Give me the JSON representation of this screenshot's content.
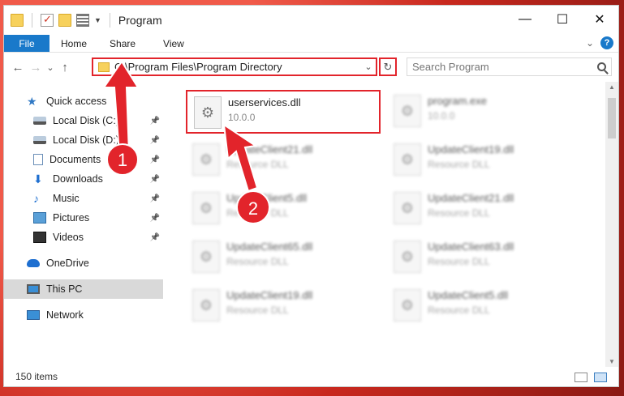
{
  "window": {
    "title": "Program",
    "minimize_glyph": "—",
    "maximize_glyph": "☐",
    "close_glyph": "✕"
  },
  "ribbon": {
    "tabs": [
      "File",
      "Home",
      "Share",
      "View"
    ],
    "help_glyph": "?",
    "expand_glyph": "⌄"
  },
  "address": {
    "path": "C:\\Program Files\\Program Directory",
    "refresh_glyph": "↻",
    "dropdown_glyph": "⌄"
  },
  "search": {
    "placeholder": "Search Program"
  },
  "nav": {
    "back_glyph": "←",
    "forward_glyph": "→",
    "recent_glyph": "⌄",
    "up_glyph": "↑",
    "items": [
      {
        "label": "Quick access",
        "icon": "star-icon",
        "pinned": false
      },
      {
        "label": "Local Disk (C:)",
        "icon": "disk-icon",
        "pinned": true
      },
      {
        "label": "Local Disk (D:)",
        "icon": "disk-icon",
        "pinned": true
      },
      {
        "label": "Documents",
        "icon": "documents-icon",
        "pinned": true
      },
      {
        "label": "Downloads",
        "icon": "downloads-icon",
        "pinned": true
      },
      {
        "label": "Music",
        "icon": "music-icon",
        "pinned": true
      },
      {
        "label": "Pictures",
        "icon": "pictures-icon",
        "pinned": true
      },
      {
        "label": "Videos",
        "icon": "videos-icon",
        "pinned": true
      },
      {
        "label": "OneDrive",
        "icon": "onedrive-icon",
        "pinned": false
      },
      {
        "label": "This PC",
        "icon": "this-pc-icon",
        "pinned": false
      },
      {
        "label": "Network",
        "icon": "network-icon",
        "pinned": false
      }
    ]
  },
  "files": [
    {
      "name": "userservices.dll",
      "desc": "10.0.0"
    },
    {
      "name": "program.exe",
      "desc": "10.0.0"
    },
    {
      "name": "UpdateClient21.dll",
      "desc": "Resource DLL"
    },
    {
      "name": "UpdateClient19.dll",
      "desc": "Resource DLL"
    },
    {
      "name": "UpdateClient5.dll",
      "desc": "Resource DLL"
    },
    {
      "name": "UpdateClient21.dll",
      "desc": "Resource DLL"
    },
    {
      "name": "UpdateClient65.dll",
      "desc": "Resource DLL"
    },
    {
      "name": "UpdateClient63.dll",
      "desc": "Resource DLL"
    },
    {
      "name": "UpdateClient19.dll",
      "desc": "Resource DLL"
    },
    {
      "name": "UpdateClient5.dll",
      "desc": "Resource DLL"
    }
  ],
  "status": {
    "count": "150 items"
  },
  "annotations": {
    "step1": "1",
    "step2": "2",
    "arrow_color": "#e2242b"
  }
}
